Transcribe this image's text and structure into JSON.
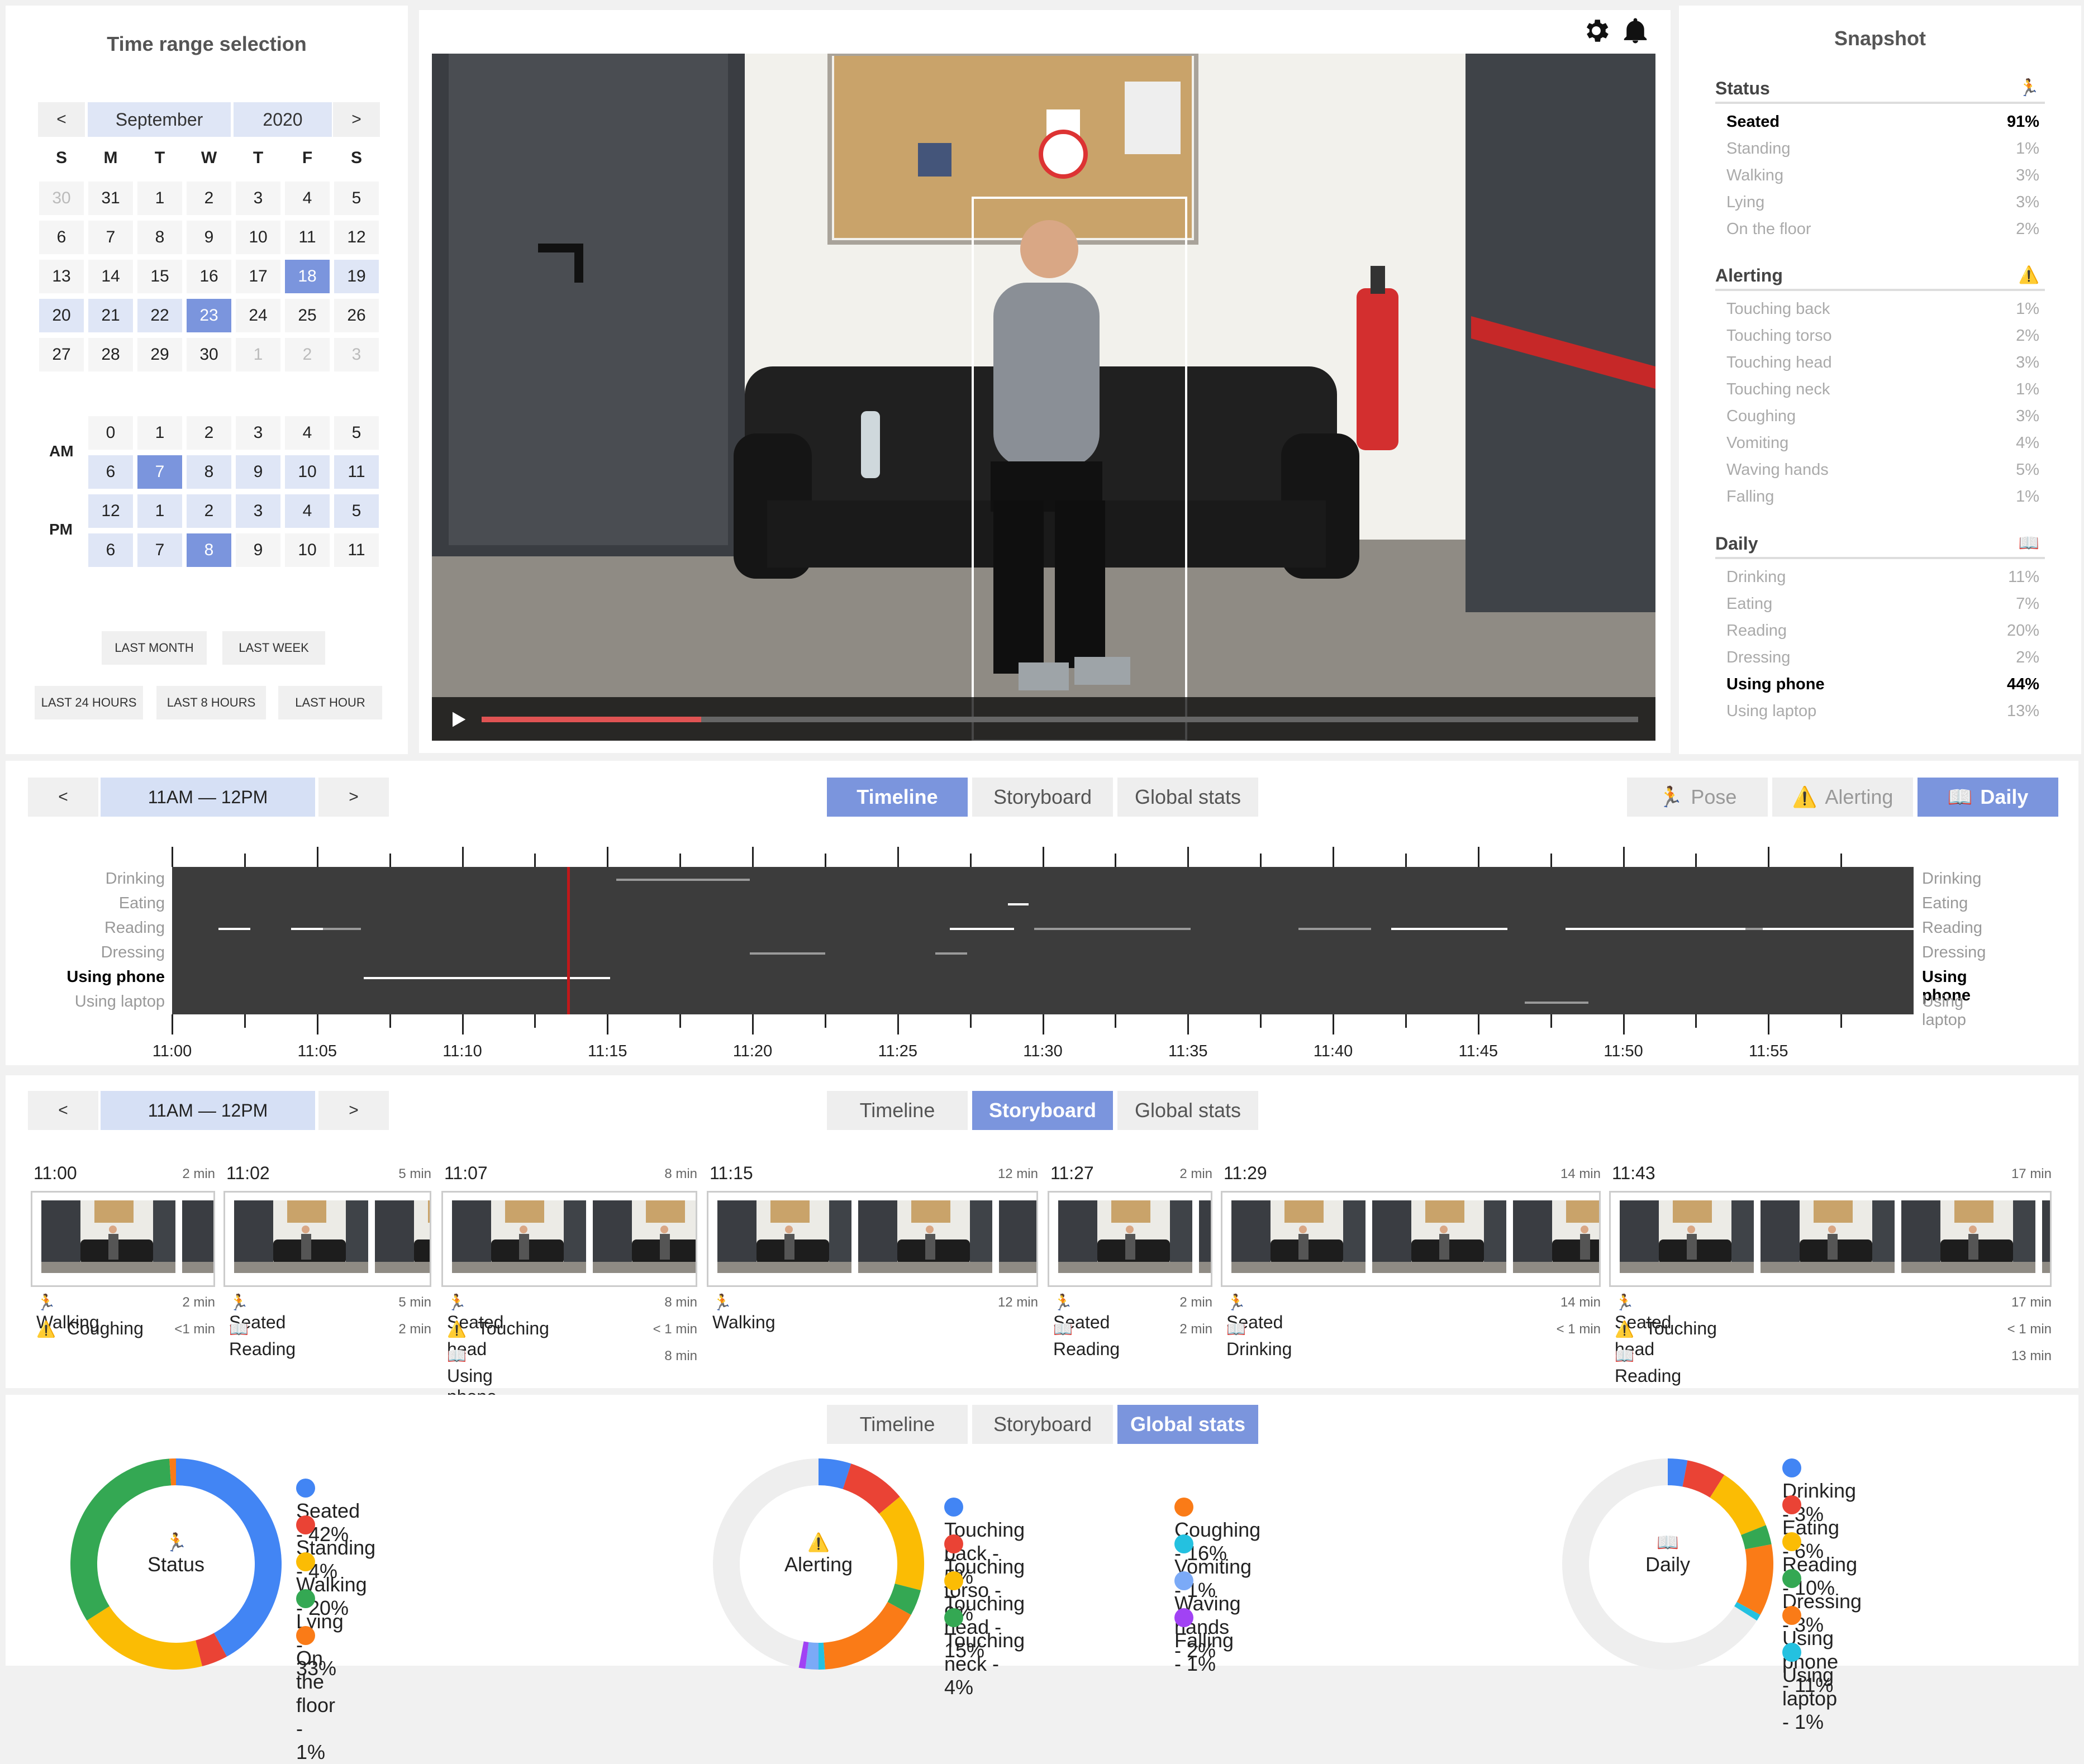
{
  "calendar": {
    "title": "Time range selection",
    "prev": "<",
    "next": ">",
    "month": "September",
    "year": "2020",
    "dow": [
      "S",
      "M",
      "T",
      "W",
      "T",
      "F",
      "S"
    ],
    "weeks": [
      [
        {
          "d": "30",
          "s": "dim"
        },
        {
          "d": "31",
          "s": ""
        },
        {
          "d": "1",
          "s": ""
        },
        {
          "d": "2",
          "s": ""
        },
        {
          "d": "3",
          "s": ""
        },
        {
          "d": "4",
          "s": ""
        },
        {
          "d": "5",
          "s": ""
        }
      ],
      [
        {
          "d": "6",
          "s": ""
        },
        {
          "d": "7",
          "s": ""
        },
        {
          "d": "8",
          "s": ""
        },
        {
          "d": "9",
          "s": ""
        },
        {
          "d": "10",
          "s": ""
        },
        {
          "d": "11",
          "s": ""
        },
        {
          "d": "12",
          "s": ""
        }
      ],
      [
        {
          "d": "13",
          "s": ""
        },
        {
          "d": "14",
          "s": ""
        },
        {
          "d": "15",
          "s": ""
        },
        {
          "d": "16",
          "s": ""
        },
        {
          "d": "17",
          "s": ""
        },
        {
          "d": "18",
          "s": "sel"
        },
        {
          "d": "19",
          "s": "range"
        }
      ],
      [
        {
          "d": "20",
          "s": "range"
        },
        {
          "d": "21",
          "s": "range"
        },
        {
          "d": "22",
          "s": "range"
        },
        {
          "d": "23",
          "s": "sel"
        },
        {
          "d": "24",
          "s": ""
        },
        {
          "d": "25",
          "s": ""
        },
        {
          "d": "26",
          "s": ""
        }
      ],
      [
        {
          "d": "27",
          "s": ""
        },
        {
          "d": "28",
          "s": ""
        },
        {
          "d": "29",
          "s": ""
        },
        {
          "d": "30",
          "s": ""
        },
        {
          "d": "1",
          "s": "dim"
        },
        {
          "d": "2",
          "s": "dim"
        },
        {
          "d": "3",
          "s": "dim"
        }
      ]
    ],
    "am_label": "AM",
    "pm_label": "PM",
    "hours": [
      [
        {
          "d": "0",
          "s": ""
        },
        {
          "d": "1",
          "s": ""
        },
        {
          "d": "2",
          "s": ""
        },
        {
          "d": "3",
          "s": ""
        },
        {
          "d": "4",
          "s": ""
        },
        {
          "d": "5",
          "s": ""
        }
      ],
      [
        {
          "d": "6",
          "s": "range"
        },
        {
          "d": "7",
          "s": "sel"
        },
        {
          "d": "8",
          "s": "range"
        },
        {
          "d": "9",
          "s": "range"
        },
        {
          "d": "10",
          "s": "range"
        },
        {
          "d": "11",
          "s": "range"
        }
      ],
      [
        {
          "d": "12",
          "s": "range"
        },
        {
          "d": "1",
          "s": "range"
        },
        {
          "d": "2",
          "s": "range"
        },
        {
          "d": "3",
          "s": "range"
        },
        {
          "d": "4",
          "s": "range"
        },
        {
          "d": "5",
          "s": "range"
        }
      ],
      [
        {
          "d": "6",
          "s": "range"
        },
        {
          "d": "7",
          "s": "range"
        },
        {
          "d": "8",
          "s": "sel"
        },
        {
          "d": "9",
          "s": ""
        },
        {
          "d": "10",
          "s": ""
        },
        {
          "d": "11",
          "s": ""
        }
      ]
    ],
    "quick": [
      "LAST MONTH",
      "LAST WEEK",
      "LAST 24 HOURS",
      "LAST 8 HOURS",
      "LAST HOUR"
    ]
  },
  "video": {
    "settings_icon": "gear-icon",
    "bell_icon": "bell-icon",
    "play_icon": "play-icon",
    "progress": 0.19
  },
  "snapshot": {
    "title": "Snapshot",
    "sections": [
      {
        "title": "Status",
        "icon": "🏃",
        "rows": [
          {
            "label": "Seated",
            "value": "91%",
            "hl": true
          },
          {
            "label": "Standing",
            "value": "1%",
            "hl": false
          },
          {
            "label": "Walking",
            "value": "3%",
            "hl": false
          },
          {
            "label": "Lying",
            "value": "3%",
            "hl": false
          },
          {
            "label": "On the floor",
            "value": "2%",
            "hl": false
          }
        ]
      },
      {
        "title": "Alerting",
        "icon": "⚠️",
        "rows": [
          {
            "label": "Touching back",
            "value": "1%",
            "hl": false
          },
          {
            "label": "Touching torso",
            "value": "2%",
            "hl": false
          },
          {
            "label": "Touching head",
            "value": "3%",
            "hl": false
          },
          {
            "label": "Touching neck",
            "value": "1%",
            "hl": false
          },
          {
            "label": "Coughing",
            "value": "3%",
            "hl": false
          },
          {
            "label": "Vomiting",
            "value": "4%",
            "hl": false
          },
          {
            "label": "Waving hands",
            "value": "5%",
            "hl": false
          },
          {
            "label": "Falling",
            "value": "1%",
            "hl": false
          }
        ]
      },
      {
        "title": "Daily",
        "icon": "📖",
        "rows": [
          {
            "label": "Drinking",
            "value": "11%",
            "hl": false
          },
          {
            "label": "Eating",
            "value": "7%",
            "hl": false
          },
          {
            "label": "Reading",
            "value": "20%",
            "hl": false
          },
          {
            "label": "Dressing",
            "value": "2%",
            "hl": false
          },
          {
            "label": "Using phone",
            "value": "44%",
            "hl": true
          },
          {
            "label": "Using laptop",
            "value": "13%",
            "hl": false
          }
        ]
      }
    ]
  },
  "nav": {
    "prev": "<",
    "next": ">",
    "hour_range": "11AM — 12PM"
  },
  "tabs": [
    "Timeline",
    "Storyboard",
    "Global stats"
  ],
  "filters": [
    {
      "icon": "🏃",
      "label": "Pose",
      "on": false
    },
    {
      "icon": "⚠️",
      "label": "Alerting",
      "on": false
    },
    {
      "icon": "📖",
      "label": "Daily",
      "on": true
    }
  ],
  "timeline": {
    "rows": [
      {
        "label": "Drinking",
        "hl": false
      },
      {
        "label": "Eating",
        "hl": false
      },
      {
        "label": "Reading",
        "hl": false
      },
      {
        "label": "Dressing",
        "hl": false
      },
      {
        "label": "Using phone",
        "hl": true
      },
      {
        "label": "Using laptop",
        "hl": false
      }
    ],
    "ticks": [
      "11:00",
      "11:05",
      "11:10",
      "11:15",
      "11:20",
      "11:25",
      "11:30",
      "11:35",
      "11:40",
      "11:45",
      "11:50",
      "11:55"
    ],
    "cursor_min": 13.6,
    "segments": [
      {
        "row": 0,
        "start": 15.3,
        "end": 19.9,
        "strong": false
      },
      {
        "row": 1,
        "start": 28.8,
        "end": 29.5,
        "strong": true
      },
      {
        "row": 2,
        "start": 1.6,
        "end": 2.7,
        "strong": true
      },
      {
        "row": 2,
        "start": 4.1,
        "end": 5.2,
        "strong": true
      },
      {
        "row": 2,
        "start": 5.2,
        "end": 6.5,
        "strong": false
      },
      {
        "row": 2,
        "start": 26.8,
        "end": 29.0,
        "strong": true
      },
      {
        "row": 2,
        "start": 29.7,
        "end": 35.1,
        "strong": false
      },
      {
        "row": 2,
        "start": 38.8,
        "end": 41.3,
        "strong": false
      },
      {
        "row": 2,
        "start": 42.0,
        "end": 46.0,
        "strong": true
      },
      {
        "row": 2,
        "start": 48.0,
        "end": 54.2,
        "strong": true
      },
      {
        "row": 2,
        "start": 54.2,
        "end": 54.8,
        "strong": false
      },
      {
        "row": 2,
        "start": 54.8,
        "end": 60.0,
        "strong": true
      },
      {
        "row": 3,
        "start": 19.9,
        "end": 21.4,
        "strong": false
      },
      {
        "row": 3,
        "start": 21.4,
        "end": 22.5,
        "strong": false
      },
      {
        "row": 3,
        "start": 26.3,
        "end": 27.4,
        "strong": false
      },
      {
        "row": 4,
        "start": 6.6,
        "end": 15.1,
        "strong": true
      },
      {
        "row": 5,
        "start": 46.6,
        "end": 48.8,
        "strong": false
      }
    ]
  },
  "storyboard": {
    "groups": [
      {
        "time": "11:00",
        "dur": "2 min",
        "n": 2,
        "acts": [
          {
            "icon": "🏃",
            "label": "Walking",
            "dur": "2 min"
          },
          {
            "icon": "⚠️",
            "label": "Coughing",
            "dur": "<1 min"
          }
        ]
      },
      {
        "time": "11:02",
        "dur": "5 min",
        "n": 2,
        "acts": [
          {
            "icon": "🏃",
            "label": "Seated",
            "dur": "5 min"
          },
          {
            "icon": "📖",
            "label": "Reading",
            "dur": "2 min"
          }
        ]
      },
      {
        "time": "11:07",
        "dur": "8 min",
        "n": 2,
        "acts": [
          {
            "icon": "🏃",
            "label": "Seated",
            "dur": "8 min"
          },
          {
            "icon": "⚠️",
            "label": "Touching head",
            "dur": "< 1 min"
          },
          {
            "icon": "📖",
            "label": "Using phone",
            "dur": "8 min"
          }
        ]
      },
      {
        "time": "11:15",
        "dur": "12 min",
        "n": 2,
        "acts": [
          {
            "icon": "🏃",
            "label": "Walking",
            "dur": "12 min"
          }
        ]
      },
      {
        "time": "11:27",
        "dur": "2 min",
        "n": 1,
        "acts": [
          {
            "icon": "🏃",
            "label": "Seated",
            "dur": "2 min"
          },
          {
            "icon": "📖",
            "label": "Reading",
            "dur": "2 min"
          }
        ]
      },
      {
        "time": "11:29",
        "dur": "14 min",
        "n": 3,
        "acts": [
          {
            "icon": "🏃",
            "label": "Seated",
            "dur": "14 min"
          },
          {
            "icon": "📖",
            "label": "Drinking",
            "dur": "< 1 min"
          }
        ]
      },
      {
        "time": "11:43",
        "dur": "17 min",
        "n": 3,
        "acts": [
          {
            "icon": "🏃",
            "label": "Seated",
            "dur": "17 min"
          },
          {
            "icon": "⚠️",
            "label": "Touching head",
            "dur": "< 1 min"
          },
          {
            "icon": "📖",
            "label": "Reading",
            "dur": "13 min"
          }
        ]
      }
    ]
  },
  "global_stats": {
    "donuts": [
      {
        "icon": "🏃",
        "label": "Status",
        "legend_cols": 1,
        "items": [
          {
            "label": "Seated - 42%",
            "value": 42,
            "color": "#4285f4"
          },
          {
            "label": "Standing - 4%",
            "value": 4,
            "color": "#ea4335"
          },
          {
            "label": "Walking - 20%",
            "value": 20,
            "color": "#fbbc04"
          },
          {
            "label": "Lying - 33%",
            "value": 33,
            "color": "#34a853"
          },
          {
            "label": "On the floor - 1%",
            "value": 1,
            "color": "#fa7b17"
          }
        ]
      },
      {
        "icon": "⚠️",
        "label": "Alerting",
        "legend_cols": 2,
        "items": [
          {
            "label": "Touching back - 5%",
            "value": 5,
            "color": "#4285f4"
          },
          {
            "label": "Touching torso - 9%",
            "value": 9,
            "color": "#ea4335"
          },
          {
            "label": "Touching head - 15%",
            "value": 15,
            "color": "#fbbc04"
          },
          {
            "label": "Touching neck - 4%",
            "value": 4,
            "color": "#34a853"
          },
          {
            "label": "Coughing - 16%",
            "value": 16,
            "color": "#fa7b17"
          },
          {
            "label": "Vomiting - 1%",
            "value": 1,
            "color": "#24c1e0"
          },
          {
            "label": "Waving hands - 2%",
            "value": 2,
            "color": "#7baaf7"
          },
          {
            "label": "Falling - 1%",
            "value": 1,
            "color": "#a142f4"
          }
        ]
      },
      {
        "icon": "📖",
        "label": "Daily",
        "legend_cols": 1,
        "items": [
          {
            "label": "Drinking - 3%",
            "value": 3,
            "color": "#4285f4"
          },
          {
            "label": "Eating - 6%",
            "value": 6,
            "color": "#ea4335"
          },
          {
            "label": "Reading - 10%",
            "value": 10,
            "color": "#fbbc04"
          },
          {
            "label": "Dressing - 3%",
            "value": 3,
            "color": "#34a853"
          },
          {
            "label": "Using phone - 11%",
            "value": 11,
            "color": "#fa7b17"
          },
          {
            "label": "Using laptop - 1%",
            "value": 1,
            "color": "#24c1e0"
          }
        ]
      }
    ],
    "remainder_color": "#eeeeee"
  }
}
